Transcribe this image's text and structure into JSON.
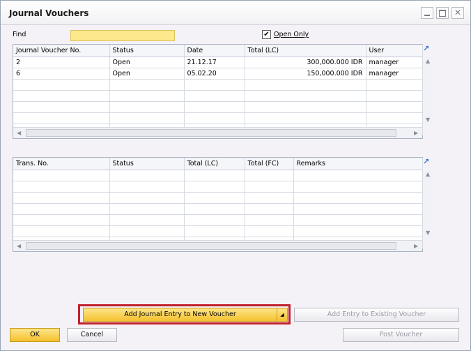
{
  "window": {
    "title": "Journal Vouchers"
  },
  "find": {
    "label": "Find",
    "value": ""
  },
  "open_only": {
    "label": "Open Only",
    "checked": true
  },
  "vouchers": {
    "columns": [
      "Journal Voucher No.",
      "Status",
      "Date",
      "Total (LC)",
      "User"
    ],
    "rows": [
      [
        "2",
        "Open",
        "21.12.17",
        "300,000.000 IDR",
        "manager"
      ],
      [
        "6",
        "Open",
        "05.02.20",
        "150,000.000 IDR",
        "manager"
      ]
    ]
  },
  "entries": {
    "columns": [
      "Trans. No.",
      "Status",
      "Total (LC)",
      "Total (FC)",
      "Remarks"
    ],
    "rows": []
  },
  "buttons": {
    "add_new": "Add Journal Entry to New Voucher",
    "add_existing": "Add Entry to Existing Voucher",
    "ok": "OK",
    "cancel": "Cancel",
    "post": "Post Voucher"
  },
  "colors": {
    "accent": "#f5c02e",
    "highlight": "#c0202a",
    "find_bg": "#fde98c"
  }
}
